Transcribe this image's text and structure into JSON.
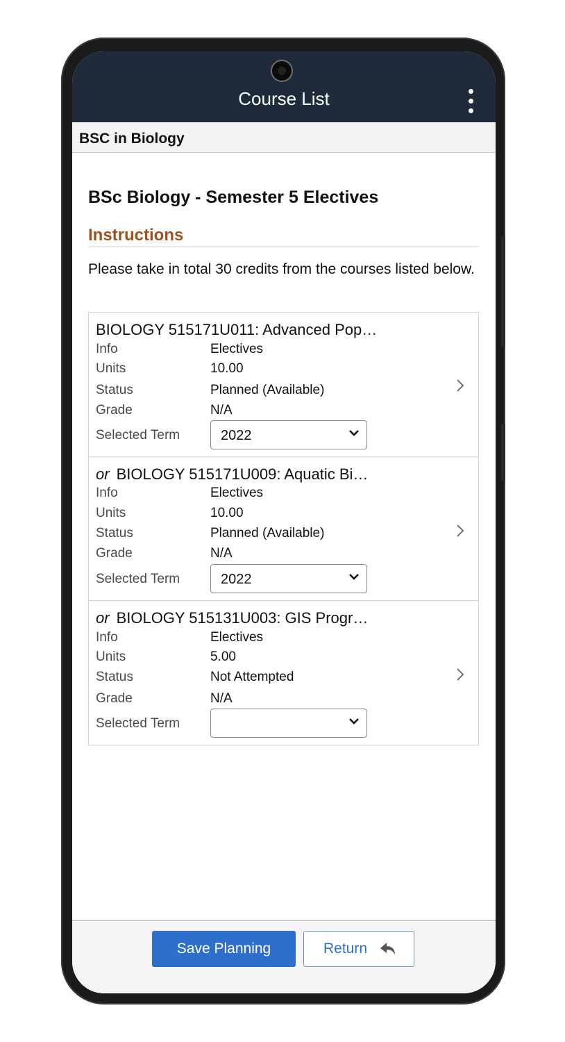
{
  "header": {
    "title": "Course List"
  },
  "subheader": {
    "program": "BSC in Biology"
  },
  "page": {
    "heading": "BSc Biology - Semester 5 Electives",
    "instructions_title": "Instructions",
    "instructions_text": "Please take in total 30 credits from the courses listed below."
  },
  "labels": {
    "info": "Info",
    "units": "Units",
    "status": "Status",
    "grade": "Grade",
    "selected_term": "Selected Term"
  },
  "courses": [
    {
      "prefix": "",
      "title": "BIOLOGY 515171U011: Advanced Pop…",
      "info": "Electives",
      "units": "10.00",
      "status": "Planned (Available)",
      "grade": "N/A",
      "term": "2022"
    },
    {
      "prefix": "or",
      "title": "BIOLOGY 515171U009: Aquatic Bi…",
      "info": "Electives",
      "units": "10.00",
      "status": "Planned (Available)",
      "grade": "N/A",
      "term": "2022"
    },
    {
      "prefix": "or",
      "title": "BIOLOGY 515131U003: GIS Progr…",
      "info": "Electives",
      "units": "5.00",
      "status": "Not Attempted",
      "grade": "N/A",
      "term": ""
    }
  ],
  "footer": {
    "save_label": "Save Planning",
    "return_label": "Return"
  },
  "icons": {
    "menu": "more-vertical-icon",
    "chevron": "chevron-right-icon",
    "return": "return-arrow-icon"
  },
  "colors": {
    "header_bg": "#1f2b3a",
    "accent": "#a0521e",
    "primary_button": "#2e6fce"
  }
}
